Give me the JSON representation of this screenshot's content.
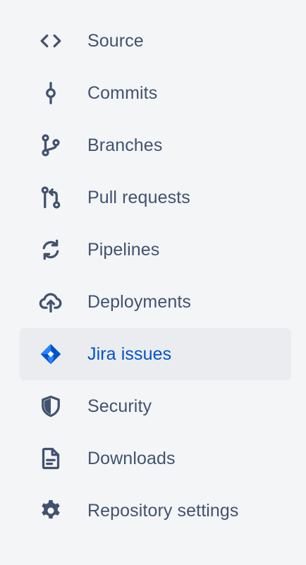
{
  "nav": {
    "selected": "Jira issues",
    "colors": {
      "text": "#42526e",
      "selected_text": "#0052cc",
      "selected_bg": "#ebecf0",
      "background": "#f4f5f7"
    },
    "items": [
      {
        "label": "Source",
        "icon": "code-icon"
      },
      {
        "label": "Commits",
        "icon": "commit-icon"
      },
      {
        "label": "Branches",
        "icon": "branch-icon"
      },
      {
        "label": "Pull requests",
        "icon": "pull-request-icon"
      },
      {
        "label": "Pipelines",
        "icon": "pipelines-icon"
      },
      {
        "label": "Deployments",
        "icon": "cloud-upload-icon"
      },
      {
        "label": "Jira issues",
        "icon": "jira-icon"
      },
      {
        "label": "Security",
        "icon": "shield-icon"
      },
      {
        "label": "Downloads",
        "icon": "document-icon"
      },
      {
        "label": "Repository settings",
        "icon": "gear-icon"
      }
    ]
  }
}
